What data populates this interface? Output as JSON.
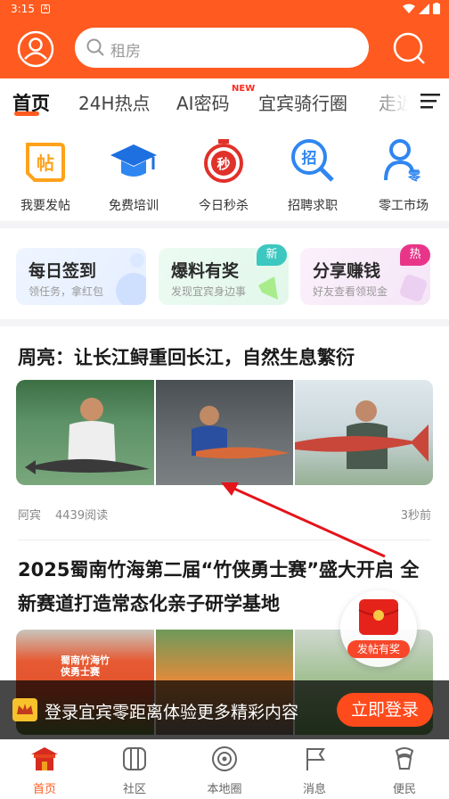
{
  "status_bar": {
    "time": "3:15"
  },
  "header": {
    "search_placeholder": "租房"
  },
  "tabs": [
    {
      "label": "首页"
    },
    {
      "label": "24H热点"
    },
    {
      "label": "AI密码",
      "badge": "NEW"
    },
    {
      "label": "宜宾骑行圈"
    },
    {
      "label": "走近"
    }
  ],
  "quick_links": [
    {
      "label": "我要发帖",
      "icon": "post-icon"
    },
    {
      "label": "免费培训",
      "icon": "graduation-cap-icon"
    },
    {
      "label": "今日秒杀",
      "icon": "flash-sale-clock-icon"
    },
    {
      "label": "招聘求职",
      "icon": "recruit-search-icon"
    },
    {
      "label": "零工市场",
      "icon": "gig-worker-icon"
    }
  ],
  "promos": [
    {
      "title": "每日签到",
      "sub": "领任务，拿红包"
    },
    {
      "title": "爆料有奖",
      "sub": "发现宜宾身边事",
      "badge": "新"
    },
    {
      "title": "分享赚钱",
      "sub": "好友查看领现金",
      "badge": "热"
    }
  ],
  "articles": [
    {
      "title": "周亮：让长江鲟重回长江，自然生息繁衍",
      "author": "阿宾",
      "reads": "4439阅读",
      "time": "3秒前"
    },
    {
      "title_line1": "2025蜀南竹海第二届“竹侠勇士赛”盛大开启 全",
      "title_line2": "新赛道打造常态化亲子研学基地",
      "image_text": "蜀南竹海竹侠勇士赛"
    }
  ],
  "floating": {
    "label": "发帖有奖"
  },
  "login_banner": {
    "text": "登录宜宾零距离体验更多精彩内容",
    "button": "立即登录"
  },
  "bottom_nav": [
    {
      "label": "首页",
      "icon": "home-gate-icon"
    },
    {
      "label": "社区",
      "icon": "community-icon"
    },
    {
      "label": "本地圈",
      "icon": "local-circle-icon"
    },
    {
      "label": "消息",
      "icon": "message-flag-icon"
    },
    {
      "label": "便民",
      "icon": "service-icon"
    }
  ],
  "colors": {
    "brand": "#ff5a1f",
    "active_nav": "#ff5a1f"
  }
}
